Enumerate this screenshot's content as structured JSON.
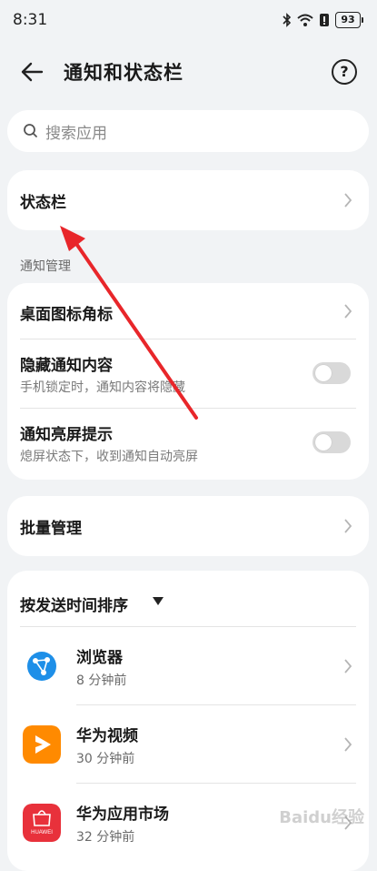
{
  "status_bar": {
    "time": "8:31",
    "battery": "93"
  },
  "header": {
    "title": "通知和状态栏",
    "help_symbol": "?"
  },
  "search": {
    "placeholder": "搜索应用"
  },
  "status_bar_setting": {
    "label": "状态栏"
  },
  "notification_section": {
    "label": "通知管理",
    "items": [
      {
        "title": "桌面图标角标",
        "type": "link"
      },
      {
        "title": "隐藏通知内容",
        "subtitle": "手机锁定时，通知内容将隐藏",
        "type": "toggle",
        "enabled": false
      },
      {
        "title": "通知亮屏提示",
        "subtitle": "熄屏状态下，收到通知自动亮屏",
        "type": "toggle",
        "enabled": false
      }
    ]
  },
  "batch": {
    "label": "批量管理"
  },
  "apps_section": {
    "sort_label": "按发送时间排序",
    "apps": [
      {
        "name": "浏览器",
        "time": "8 分钟前",
        "icon": "browser-icon"
      },
      {
        "name": "华为视频",
        "time": "30 分钟前",
        "icon": "huawei-video-icon"
      },
      {
        "name": "华为应用市场",
        "time": "32 分钟前",
        "icon": "huawei-appgallery-icon",
        "icon_text": "HUAWEI"
      }
    ]
  },
  "colors": {
    "annotation_arrow": "#e8262a",
    "appgallery_red": "#e8313b",
    "video_orange": "#ff8a00",
    "browser_blue": "#1e8fe8"
  },
  "watermark": {
    "text": "Baidu经验"
  }
}
